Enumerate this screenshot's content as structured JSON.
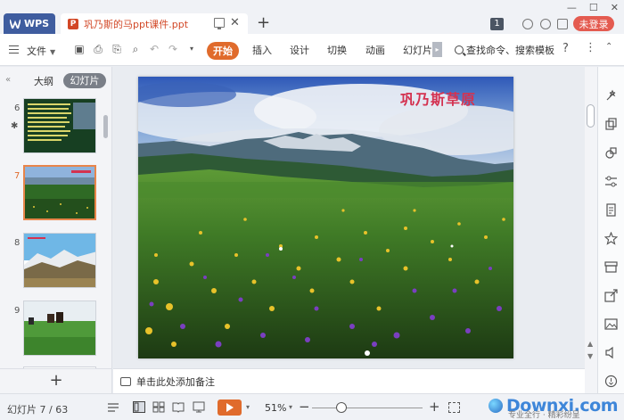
{
  "titlebar": {
    "wps_label": "WPS",
    "doc_title": "巩乃斯的马ppt课件.ppt",
    "notification_count": "1",
    "login_label": "未登录"
  },
  "ribbon": {
    "file_label": "文件",
    "tabs": [
      "开始",
      "插入",
      "设计",
      "切换",
      "动画",
      "幻灯片"
    ],
    "active_tab": "开始",
    "search_label": "查找命令、搜索模板"
  },
  "left_panel": {
    "tab_outline": "大纲",
    "tab_slides": "幻灯片",
    "slides": [
      {
        "number": "6"
      },
      {
        "number": "7",
        "active": true
      },
      {
        "number": "8"
      },
      {
        "number": "9"
      }
    ]
  },
  "slide": {
    "title": "巩乃斯草原"
  },
  "notes": {
    "placeholder": "单击此处添加备注"
  },
  "statusbar": {
    "slide_indicator": "幻灯片 7 / 63",
    "zoom": "51%",
    "watermark": "Downxi.com",
    "watermark_sub": "专业全行 · 精彩纷呈"
  },
  "colors": {
    "accent": "#e06b2c",
    "login": "#e45b50",
    "wps_tab": "#3f5d9f",
    "slide_title": "#d43250"
  }
}
